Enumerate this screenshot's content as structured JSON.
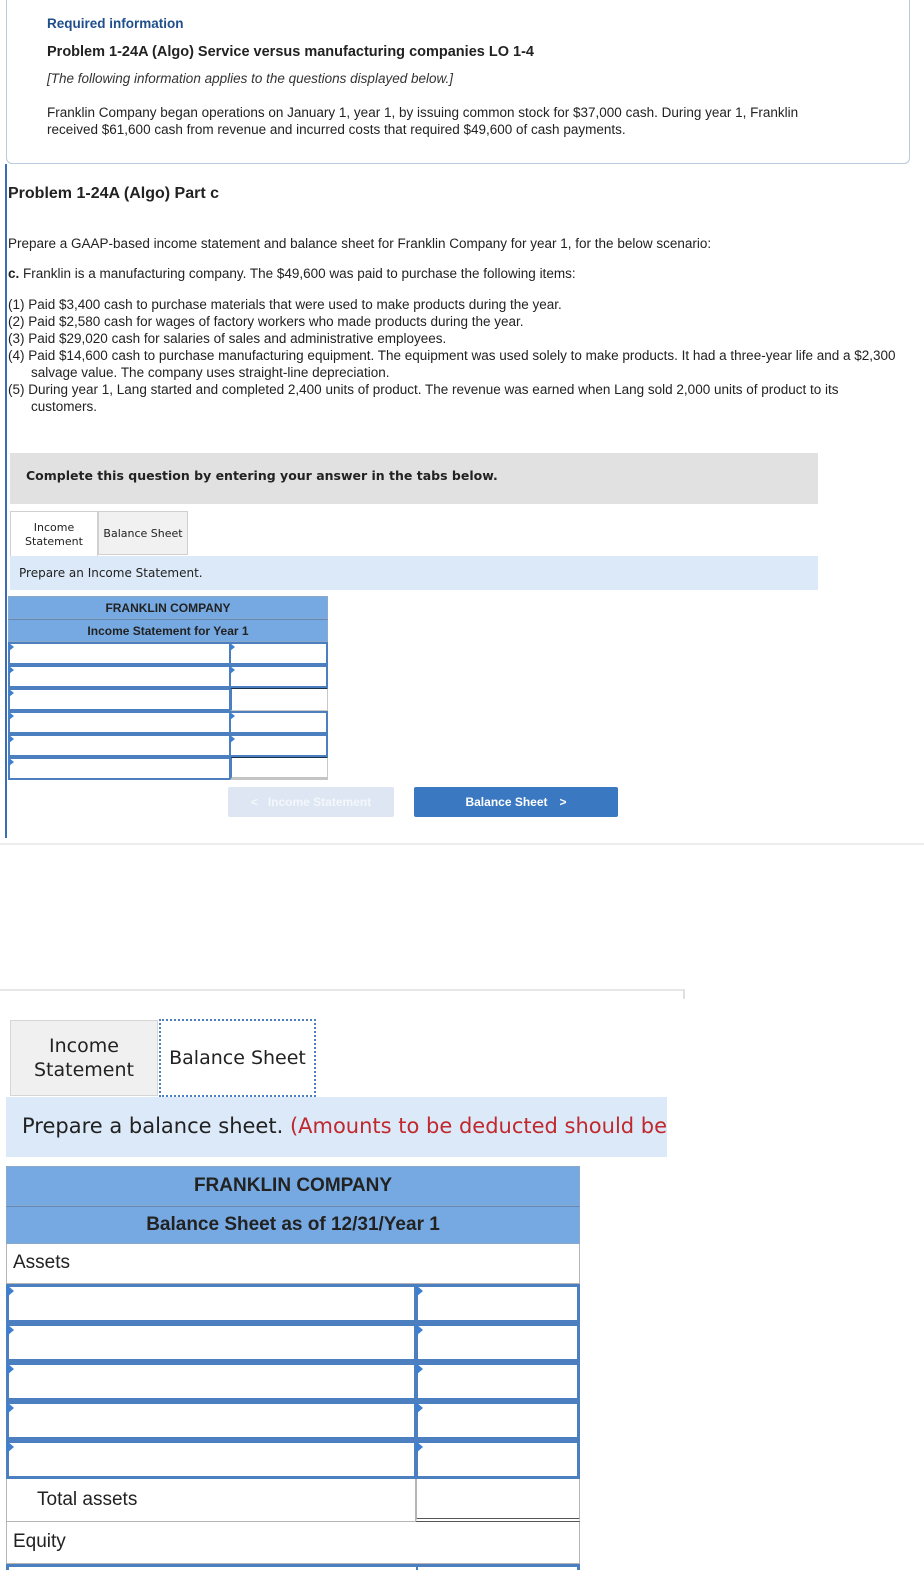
{
  "info": {
    "required_label": "Required information",
    "problem_title": "Problem 1-24A (Algo) Service versus manufacturing companies LO 1-4",
    "applies_note": "[The following information applies to the questions displayed below.]",
    "description": "Franklin Company began operations on January 1, year 1, by issuing common stock for $37,000 cash. During year 1, Franklin received $61,600 cash from revenue and incurred costs that required $49,600 of cash payments."
  },
  "part": {
    "title": "Problem 1-24A (Algo) Part c",
    "prompt": "Prepare a GAAP-based income statement and balance sheet for Franklin Company for year 1, for the below scenario:",
    "scenario_label": "c.",
    "scenario_text": " Franklin is a manufacturing company. The $49,600 was paid to purchase the following items:",
    "items": [
      "(1) Paid $3,400 cash to purchase materials that were used to make products during the year.",
      "(2) Paid $2,580 cash for wages of factory workers who made products during the year.",
      "(3) Paid $29,020 cash for salaries of sales and administrative employees.",
      "(4) Paid $14,600 cash to purchase manufacturing equipment. The equipment was used solely to make products. It had a three-year life and a $2,300 salvage value. The company uses straight-line depreciation.",
      "(5) During year 1, Lang started and completed 2,400 units of product. The revenue was earned when Lang sold 2,000 units of product to its customers."
    ]
  },
  "question": {
    "complete_instruction": "Complete this question by entering your answer in the tabs below.",
    "tabs": [
      {
        "label": "Income Statement",
        "active": true
      },
      {
        "label": "Balance Sheet",
        "active": false
      }
    ],
    "income_statement": {
      "instruction": "Prepare an Income Statement.",
      "company": "FRANKLIN COMPANY",
      "title": "Income Statement for Year 1",
      "rows": [
        {
          "label": "",
          "amount": ""
        },
        {
          "label": "",
          "amount": ""
        },
        {
          "label": "",
          "amount": ""
        },
        {
          "label": "",
          "amount": ""
        },
        {
          "label": "",
          "amount": ""
        },
        {
          "label": "",
          "amount": ""
        }
      ]
    },
    "nav": {
      "prev_label": "Income Statement",
      "prev_icon": "chevron-left",
      "prev_glyph": "<",
      "next_label": "Balance Sheet",
      "next_icon": "chevron-right",
      "next_glyph": ">"
    }
  },
  "balance_question": {
    "tabs": [
      {
        "label": "Income Statement",
        "active": false
      },
      {
        "label": "Balance Sheet",
        "active": true
      }
    ],
    "instruction": "Prepare a balance sheet.",
    "instruction_note": "(Amounts to be deducted should be",
    "company": "FRANKLIN COMPANY",
    "title": "Balance Sheet as of 12/31/Year 1",
    "assets_label": "Assets",
    "asset_rows": [
      {
        "label": "",
        "amount": ""
      },
      {
        "label": "",
        "amount": ""
      },
      {
        "label": "",
        "amount": ""
      },
      {
        "label": "",
        "amount": ""
      },
      {
        "label": "",
        "amount": ""
      }
    ],
    "total_assets_label": "Total assets",
    "total_assets_value": "",
    "equity_label": "Equity"
  },
  "colors": {
    "accent": "#3b78c2",
    "table_header": "#76a9e2",
    "instruction_bg": "#dbe9f8",
    "note_red": "#c0282d"
  }
}
